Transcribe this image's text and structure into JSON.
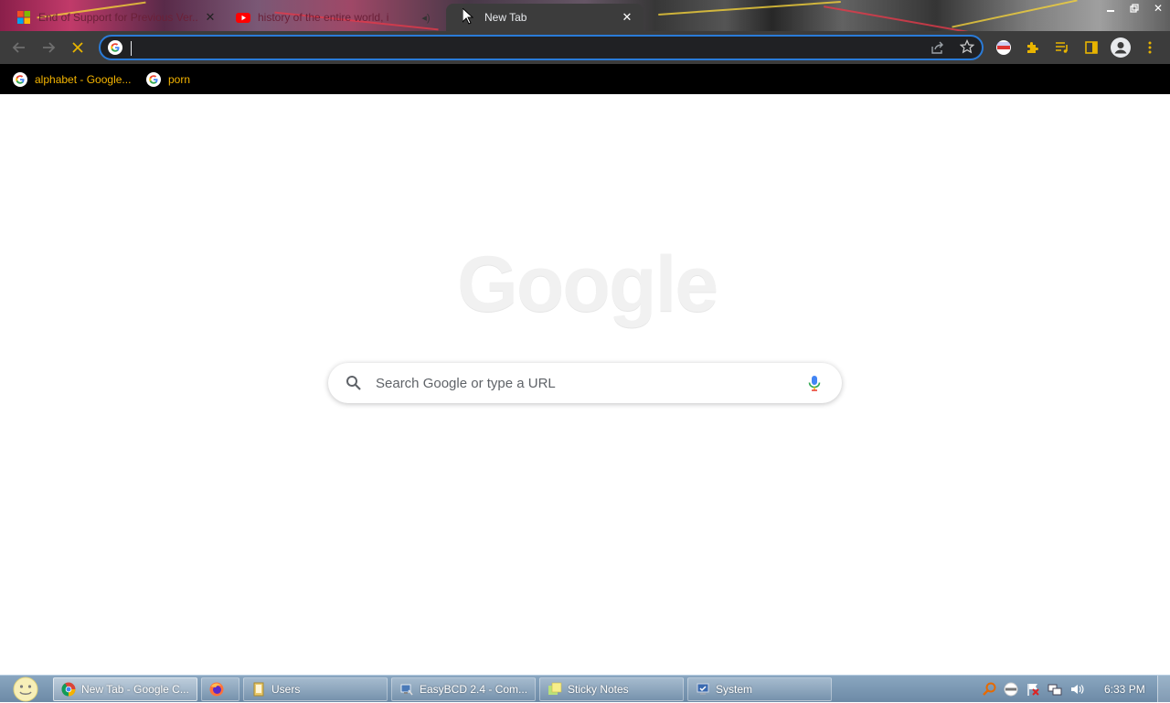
{
  "browser": {
    "tabs": [
      {
        "title": "End of Support for Previous Ver...",
        "icon": "microsoft-icon",
        "active": false
      },
      {
        "title": "history of the entire world, i",
        "icon": "youtube-icon",
        "active": false
      },
      {
        "title": "New Tab",
        "icon": "",
        "active": true
      }
    ],
    "omnibox": {
      "value": "",
      "placeholder": ""
    },
    "bookmarks": [
      {
        "label": "alphabet - Google...",
        "icon": "google-icon"
      },
      {
        "label": "porn",
        "icon": "google-icon"
      }
    ],
    "accent_color": "#2a7bd8",
    "bookmark_text_color": "#f4b400"
  },
  "page": {
    "logo_text": "Google",
    "search_placeholder": "Search Google or type a URL"
  },
  "taskbar": {
    "tasks": [
      {
        "label": "New Tab - Google C...",
        "icon": "chrome-icon",
        "active": true
      },
      {
        "label": "",
        "icon": "firefox-icon",
        "active": false
      },
      {
        "label": "Users",
        "icon": "folder-icon",
        "active": false
      },
      {
        "label": "EasyBCD 2.4 - Com...",
        "icon": "easybcd-icon",
        "active": false
      },
      {
        "label": "Sticky Notes",
        "icon": "sticky-notes-icon",
        "active": false
      },
      {
        "label": "System",
        "icon": "system-icon",
        "active": false
      }
    ],
    "clock": "6:33 PM"
  }
}
